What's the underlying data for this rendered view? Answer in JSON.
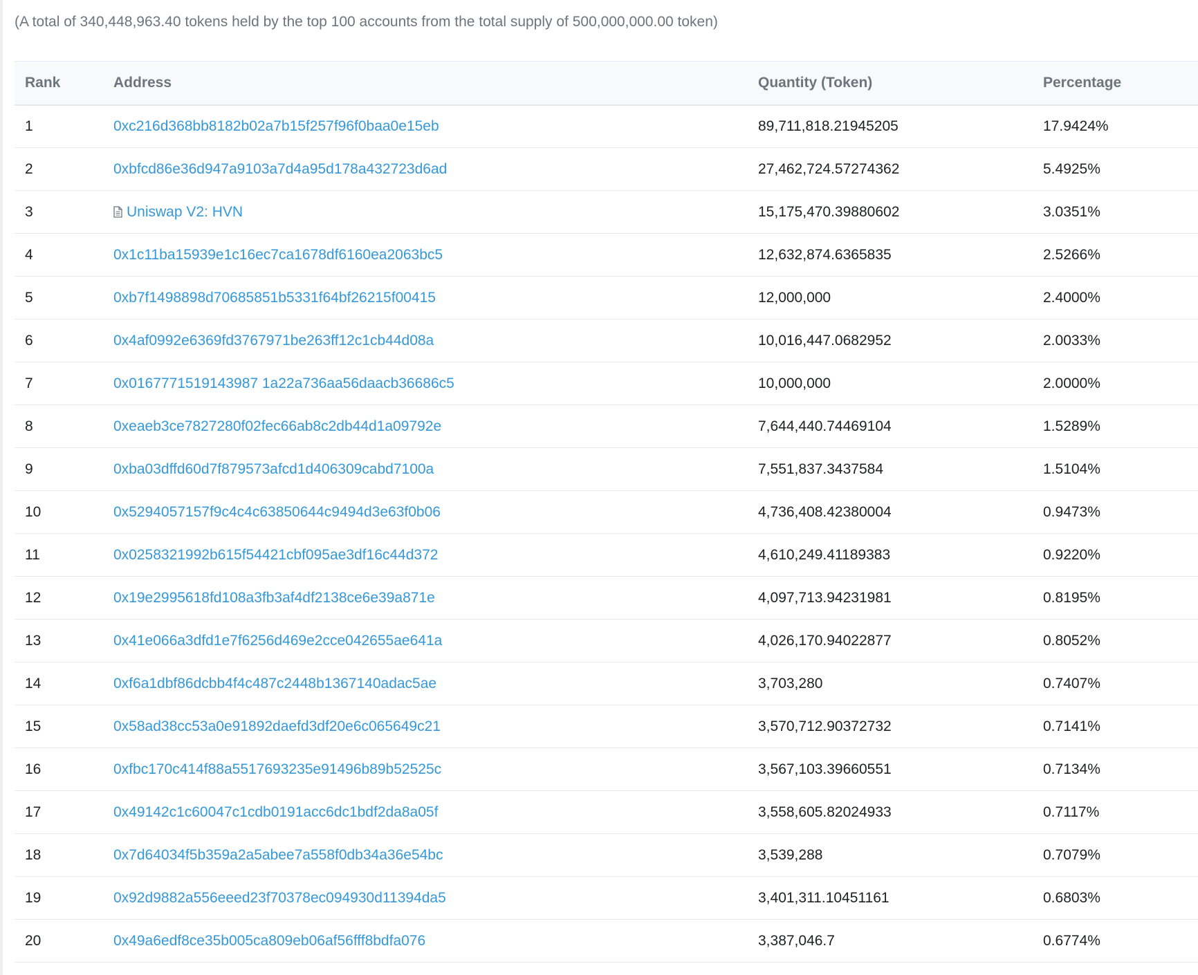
{
  "summary": "(A total of 340,448,963.40 tokens held by the top 100 accounts from the total supply of 500,000,000.00 token)",
  "table": {
    "headers": {
      "rank": "Rank",
      "address": "Address",
      "quantity": "Quantity (Token)",
      "percentage": "Percentage"
    },
    "rows": [
      {
        "rank": "1",
        "address": "0xc216d368bb8182b02a7b15f257f96f0baa0e15eb",
        "quantity": "89,711,818.21945205",
        "percentage": "17.9424%"
      },
      {
        "rank": "2",
        "address": "0xbfcd86e36d947a9103a7d4a95d178a432723d6ad",
        "quantity": "27,462,724.57274362",
        "percentage": "5.4925%"
      },
      {
        "rank": "3",
        "address": "Uniswap V2: HVN",
        "contract_icon": "contract-document-icon",
        "quantity": "15,175,470.39880602",
        "percentage": "3.0351%"
      },
      {
        "rank": "4",
        "address": "0x1c11ba15939e1c16ec7ca1678df6160ea2063bc5",
        "quantity": "12,632,874.6365835",
        "percentage": "2.5266%"
      },
      {
        "rank": "5",
        "address": "0xb7f1498898d70685851b5331f64bf26215f00415",
        "quantity": "12,000,000",
        "percentage": "2.4000%"
      },
      {
        "rank": "6",
        "address": "0x4af0992e6369fd3767971be263ff12c1cb44d08a",
        "quantity": "10,016,447.0682952",
        "percentage": "2.0033%"
      },
      {
        "rank": "7",
        "address": "0x0167771519143987 1a22a736aa56daacb36686c5",
        "quantity": "10,000,000",
        "percentage": "2.0000%"
      },
      {
        "rank": "8",
        "address": "0xeaeb3ce7827280f02fec66ab8c2db44d1a09792e",
        "quantity": "7,644,440.74469104",
        "percentage": "1.5289%"
      },
      {
        "rank": "9",
        "address": "0xba03dffd60d7f879573afcd1d406309cabd7100a",
        "quantity": "7,551,837.3437584",
        "percentage": "1.5104%"
      },
      {
        "rank": "10",
        "address": "0x5294057157f9c4c4c63850644c9494d3e63f0b06",
        "quantity": "4,736,408.42380004",
        "percentage": "0.9473%"
      },
      {
        "rank": "11",
        "address": "0x0258321992b615f54421cbf095ae3df16c44d372",
        "quantity": "4,610,249.41189383",
        "percentage": "0.9220%"
      },
      {
        "rank": "12",
        "address": "0x19e2995618fd108a3fb3af4df2138ce6e39a871e",
        "quantity": "4,097,713.94231981",
        "percentage": "0.8195%"
      },
      {
        "rank": "13",
        "address": "0x41e066a3dfd1e7f6256d469e2cce042655ae641a",
        "quantity": "4,026,170.94022877",
        "percentage": "0.8052%"
      },
      {
        "rank": "14",
        "address": "0xf6a1dbf86dcbb4f4c487c2448b1367140adac5ae",
        "quantity": "3,703,280",
        "percentage": "0.7407%"
      },
      {
        "rank": "15",
        "address": "0x58ad38cc53a0e91892daefd3df20e6c065649c21",
        "quantity": "3,570,712.90372732",
        "percentage": "0.7141%"
      },
      {
        "rank": "16",
        "address": "0xfbc170c414f88a5517693235e91496b89b52525c",
        "quantity": "3,567,103.39660551",
        "percentage": "0.7134%"
      },
      {
        "rank": "17",
        "address": "0x49142c1c60047c1cdb0191acc6dc1bdf2da8a05f",
        "quantity": "3,558,605.82024933",
        "percentage": "0.7117%"
      },
      {
        "rank": "18",
        "address": "0x7d64034f5b359a2a5abee7a558f0db34a36e54bc",
        "quantity": "3,539,288",
        "percentage": "0.7079%"
      },
      {
        "rank": "19",
        "address": "0x92d9882a556eeed23f70378ec094930d11394da5",
        "quantity": "3,401,311.10451161",
        "percentage": "0.6803%"
      },
      {
        "rank": "20",
        "address": "0x49a6edf8ce35b005ca809eb06af56fff8bdfa076",
        "quantity": "3,387,046.7",
        "percentage": "0.6774%"
      }
    ]
  },
  "colors": {
    "link": "#3498db",
    "header_text": "#6c757d",
    "header_bg": "#f8f9fa",
    "row_border": "#e7eaf3"
  }
}
